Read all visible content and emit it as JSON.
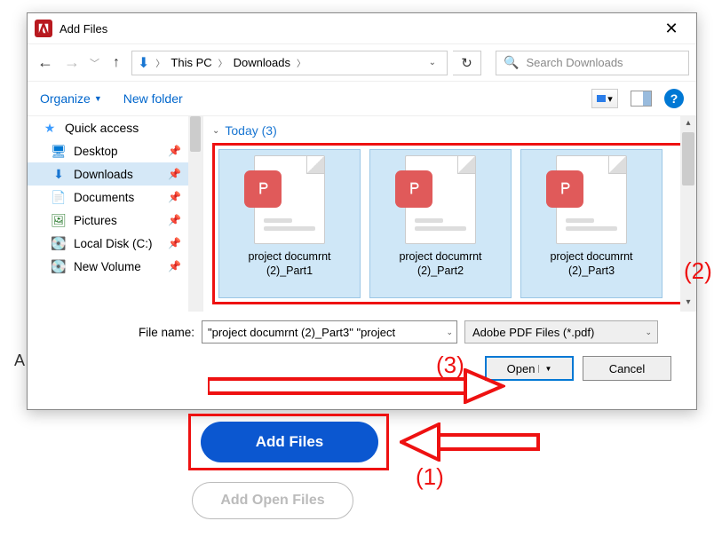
{
  "titlebar": {
    "title": "Add Files"
  },
  "path": {
    "seg1": "This PC",
    "seg2": "Downloads"
  },
  "search": {
    "placeholder": "Search Downloads"
  },
  "toolbar": {
    "organize": "Organize",
    "newfolder": "New folder"
  },
  "sidebar": {
    "quick": "Quick access",
    "desktop": "Desktop",
    "downloads": "Downloads",
    "documents": "Documents",
    "pictures": "Pictures",
    "localc": "Local Disk (C:)",
    "newvol": "New Volume"
  },
  "group": {
    "header": "Today (3)"
  },
  "files": {
    "f1a": "project documrnt",
    "f1b": "(2)_Part1",
    "f2a": "project documrnt",
    "f2b": "(2)_Part2",
    "f3a": "project documrnt",
    "f3b": "(2)_Part3"
  },
  "footer": {
    "fnlabel": "File name:",
    "fnvalue": "\"project documrnt (2)_Part3\" \"project",
    "filter": "Adobe PDF Files (*.pdf)",
    "open": "Open",
    "cancel": "Cancel"
  },
  "below": {
    "addfiles": "Add Files",
    "addopen": "Add Open Files",
    "ac": "A"
  },
  "anno": {
    "n1": "(1)",
    "n2": "(2)",
    "n3": "(3)"
  }
}
